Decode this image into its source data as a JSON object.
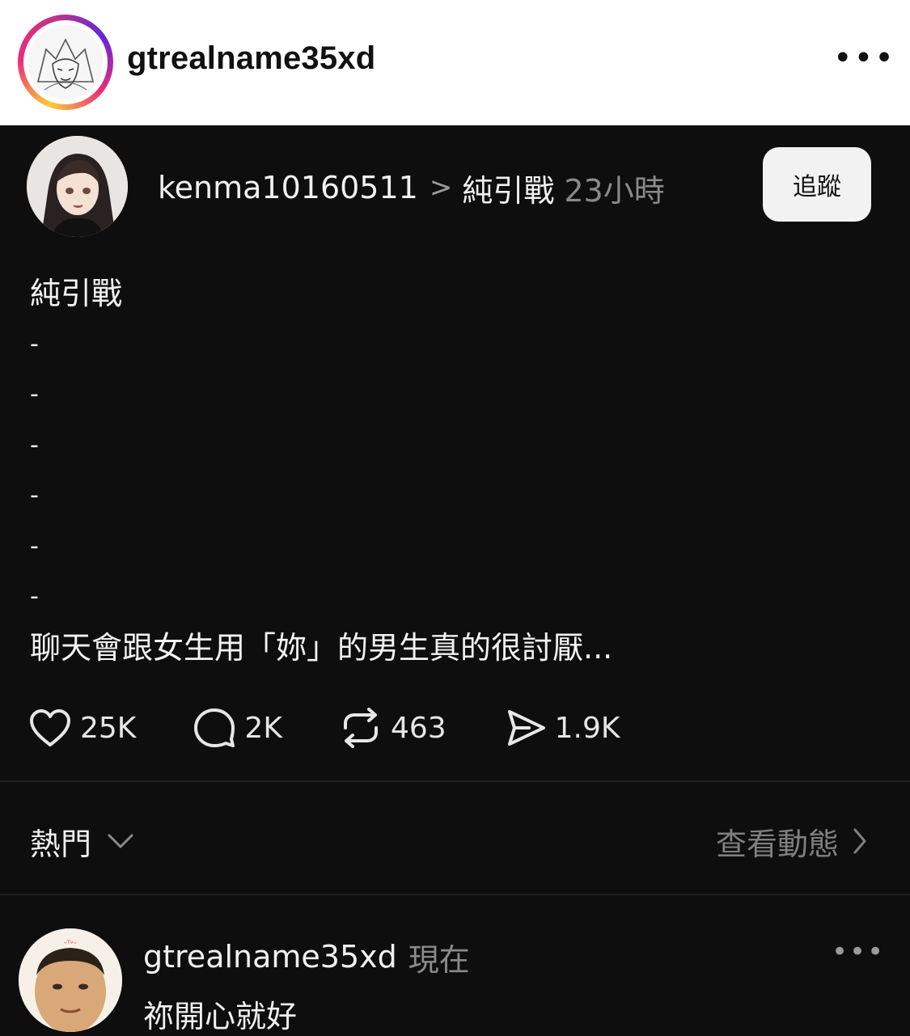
{
  "header": {
    "username": "gtrealname35xd",
    "more_icon": "more-horizontal-icon"
  },
  "post": {
    "author": "kenma10160511",
    "topic": "純引戰",
    "time": "23小時",
    "follow_label": "追蹤",
    "lines": [
      "純引戰",
      "-",
      "-",
      "-",
      "-",
      "-",
      "-",
      "聊天會跟女生用「妳」的男生真的很討厭..."
    ],
    "stats": {
      "likes": "25K",
      "comments": "2K",
      "reposts": "463",
      "shares": "1.9K"
    }
  },
  "sort": {
    "label": "熱門",
    "activity_label": "查看動態"
  },
  "reply": {
    "author": "gtrealname35xd",
    "time": "現在",
    "text": "祢開心就好"
  }
}
